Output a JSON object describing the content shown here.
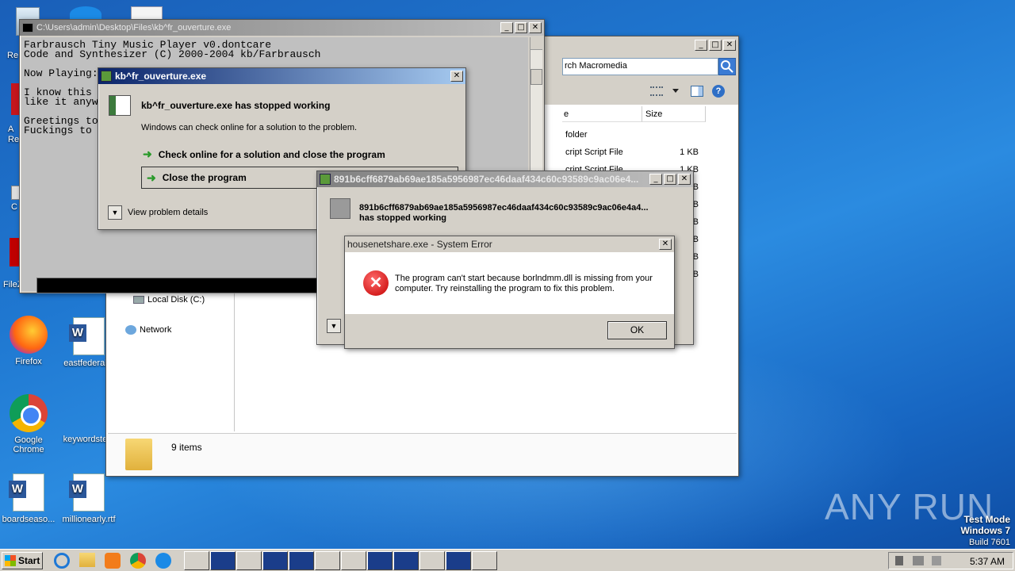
{
  "desktop": {
    "icons": [
      {
        "label": "Re"
      },
      {
        "label": "A\nRe"
      },
      {
        "label": "C"
      },
      {
        "label": "FileZilla C"
      },
      {
        "label": "Firefox"
      },
      {
        "label": "eastfederal..."
      },
      {
        "label": "Google Chrome"
      },
      {
        "label": "keywordste..."
      },
      {
        "label": "boardseaso..."
      },
      {
        "label": "millionearly.rtf"
      }
    ],
    "watermark": {
      "brand": "ANY RUN",
      "test_mode": "Test Mode",
      "os": "Windows 7",
      "build": "Build 7601"
    }
  },
  "console": {
    "title": "C:\\Users\\admin\\Desktop\\Files\\kb^fr_ouverture.exe",
    "lines": [
      "Farbrausch Tiny Music Player v0.dontcare",
      "Code and Synthesizer (C) 2000-2004 kb/Farbrausch",
      "",
      "Now Playing:",
      "",
      "I know this",
      "like it anyw",
      "",
      "Greetings to",
      "Fuckings to"
    ]
  },
  "explorer": {
    "search_placeholder": "rch Macromedia",
    "col_name": "e",
    "col_size": "Size",
    "rows": [
      {
        "name": "folder",
        "size": ""
      },
      {
        "name": "cript Script File",
        "size": "1 KB"
      },
      {
        "name": "cript Script File",
        "size": "1 KB"
      },
      {
        "name": "",
        "size": "B"
      },
      {
        "name": "",
        "size": "B"
      },
      {
        "name": "",
        "size": "B"
      },
      {
        "name": "",
        "size": "B"
      },
      {
        "name": "",
        "size": "B"
      },
      {
        "name": "",
        "size": "B"
      }
    ],
    "nav": {
      "local_disk": "Local Disk (C:)",
      "network": "Network"
    },
    "status": "9 items"
  },
  "dialog1": {
    "title": "kb^fr_ouverture.exe",
    "heading": "kb^fr_ouverture.exe has stopped working",
    "subtext": "Windows can check online for a solution to the problem.",
    "option1": "Check online for a solution and close the program",
    "option2": "Close the program",
    "details": "View problem details"
  },
  "dialog2": {
    "title": "891b6cff6879ab69ae185a5956987ec46daaf434c60c93589c9ac06e4...",
    "heading_line1": "891b6cff6879ab69ae185a5956987ec46daaf434c60c93589c9ac06e4a4...",
    "heading_line2": "has stopped working"
  },
  "dialog3": {
    "title": "housenetshare.exe - System Error",
    "message": "The program can't start because borlndmm.dll is missing from your computer. Try reinstalling the program to fix this problem.",
    "ok": "OK"
  },
  "taskbar": {
    "start": "Start",
    "clock": "5:37 AM"
  }
}
